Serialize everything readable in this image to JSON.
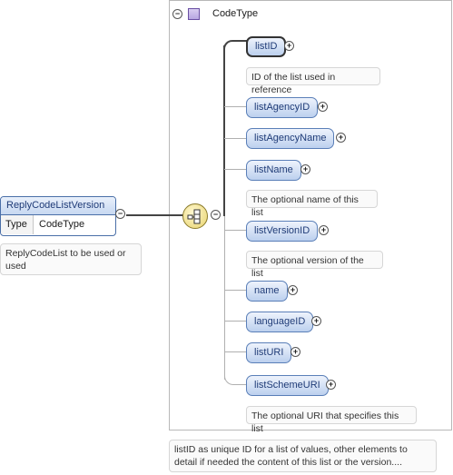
{
  "type_box": {
    "title": "CodeType"
  },
  "root": {
    "name": "ReplyCodeListVersion",
    "type_key": "Type",
    "type_value": "CodeType",
    "doc": "ReplyCodeList to be used or used"
  },
  "children": [
    {
      "name": "listID",
      "doc": "ID of the list used in reference"
    },
    {
      "name": "listAgencyID",
      "doc": ""
    },
    {
      "name": "listAgencyName",
      "doc": ""
    },
    {
      "name": "listName",
      "doc": "The optional name of this list"
    },
    {
      "name": "listVersionID",
      "doc": "The optional version of the list"
    },
    {
      "name": "name",
      "doc": ""
    },
    {
      "name": "languageID",
      "doc": ""
    },
    {
      "name": "listURI",
      "doc": ""
    },
    {
      "name": "listSchemeURI",
      "doc": "The optional URI that specifies this list"
    }
  ],
  "type_doc": "listID as unique ID for a list of values, other elements to detail if needed the content of this list or the version....",
  "symbols": {
    "collapse": "−",
    "expand": "+"
  }
}
